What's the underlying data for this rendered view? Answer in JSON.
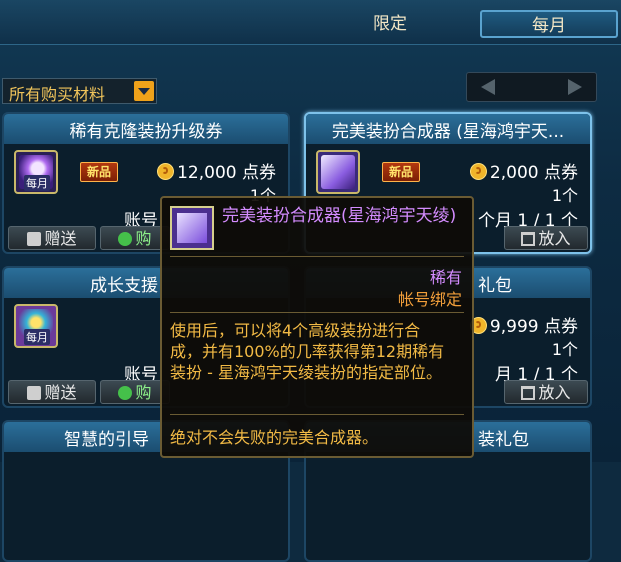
{
  "tabs": {
    "limited": "限定",
    "monthly": "每月"
  },
  "filter": {
    "selected": "所有购买材料"
  },
  "cards": [
    {
      "title": "稀有克隆装扮升级券",
      "new_label": "新品",
      "price": "12,000 点券",
      "qty": "1个",
      "account": "账号",
      "month_tag": "每月",
      "gift_label": "赠送",
      "buy_label": "购"
    },
    {
      "title": "完美装扮合成器 (星海鸿宇天...",
      "new_label": "新品",
      "price": "2,000 点券",
      "qty": "1个",
      "account": "个月 1 / 1 个",
      "month_tag": "",
      "cart_label": "放入"
    },
    {
      "title": "成长支援",
      "price": "",
      "qty": "",
      "account": "账号",
      "month_tag": "每月",
      "gift_label": "赠送",
      "buy_label": "购"
    },
    {
      "title": "礼包",
      "price": "9,999 点券",
      "qty": "1个",
      "account": "月 1 / 1 个",
      "cart_label": "放入"
    },
    {
      "title": "智慧的引导"
    },
    {
      "title": "装礼包"
    }
  ],
  "tooltip": {
    "title": "完美装扮合成器(星海鸿宇天绫)",
    "rarity": "稀有",
    "bind": "帐号绑定",
    "description": "使用后，可以将4个高级装扮进行合成，并有100%的几率获得第12期稀有装扮 - 星海鸿宇天绫装扮的指定部位。",
    "note": "绝对不会失败的完美合成器。"
  },
  "colors": {
    "rare": "#d48cff",
    "bind": "#f29f3a",
    "desc": "#f2ba45",
    "selected_border": "#7ec2ea"
  }
}
